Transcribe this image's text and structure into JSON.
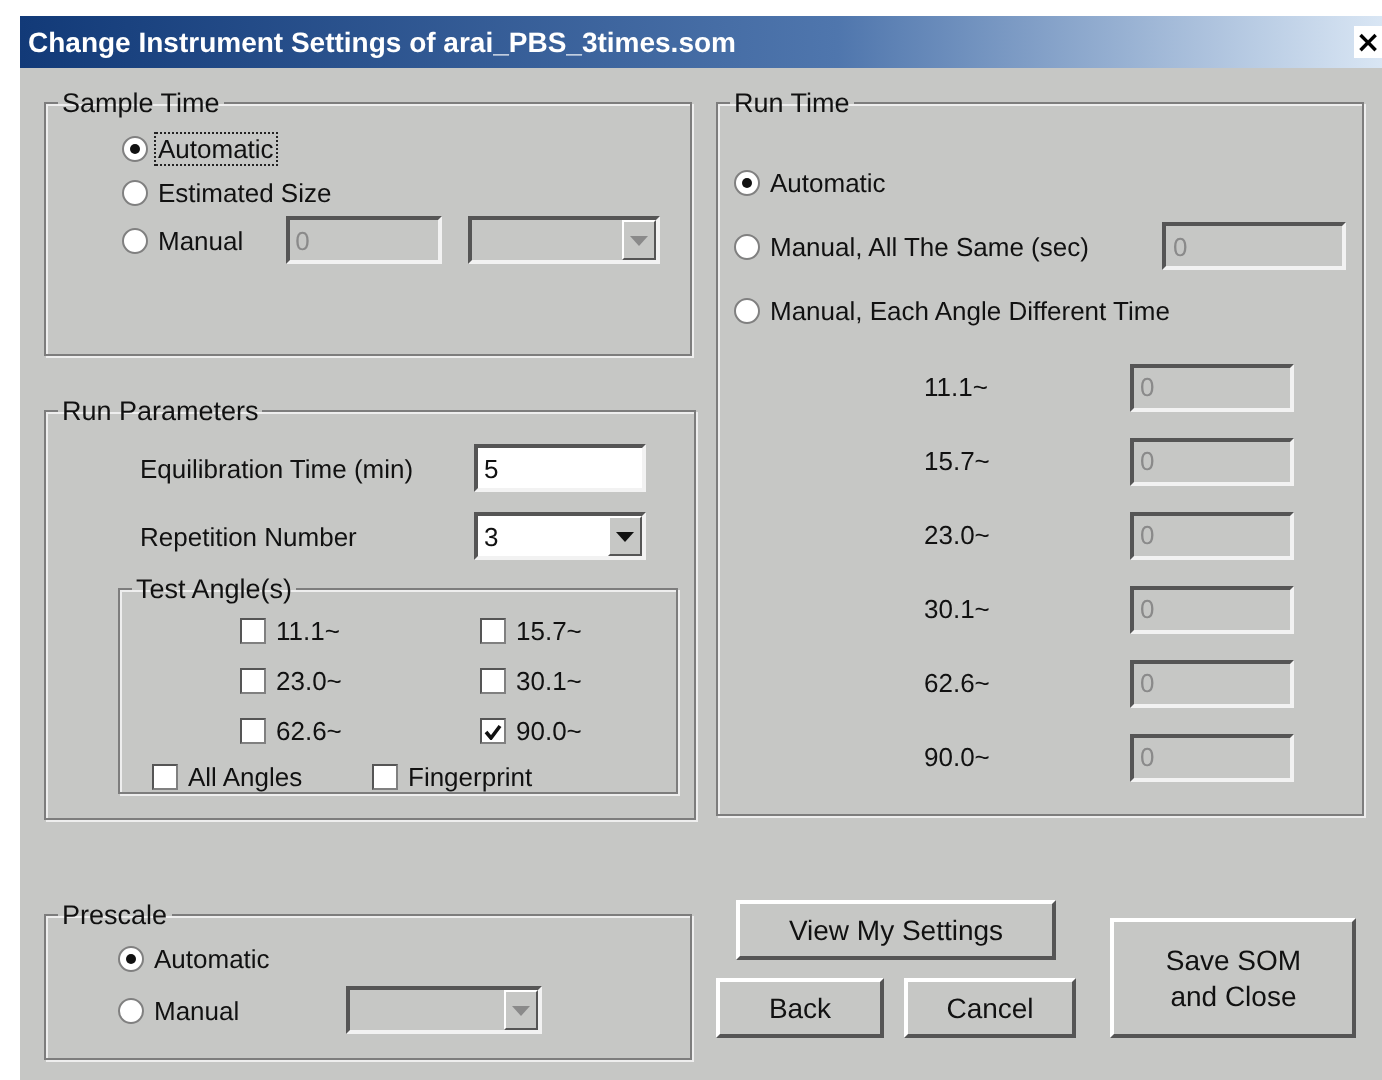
{
  "window": {
    "title": "Change Instrument Settings of arai_PBS_3times.som",
    "close": "×"
  },
  "sample_time": {
    "title": "Sample Time",
    "options": [
      {
        "label": "Automatic",
        "selected": true,
        "focused": true
      },
      {
        "label": "Estimated Size",
        "selected": false,
        "focused": false
      },
      {
        "label": "Manual",
        "selected": false,
        "focused": false
      }
    ],
    "manual_value": "0"
  },
  "run_parameters": {
    "title": "Run Parameters",
    "fields": [
      {
        "label": "Equilibration Time (min)",
        "value": "5",
        "kind": "text"
      },
      {
        "label": "Repetition Number",
        "value": "3",
        "kind": "dropdown"
      }
    ],
    "test_angles": {
      "title": "Test Angle(s)",
      "angles": [
        {
          "label": "11.1~",
          "checked": false
        },
        {
          "label": "15.7~",
          "checked": false
        },
        {
          "label": "23.0~",
          "checked": false
        },
        {
          "label": "30.1~",
          "checked": false
        },
        {
          "label": "62.6~",
          "checked": false
        },
        {
          "label": "90.0~",
          "checked": true
        }
      ],
      "extras": [
        {
          "label": "All Angles",
          "checked": false
        },
        {
          "label": "Fingerprint",
          "checked": false
        }
      ]
    }
  },
  "run_time": {
    "title": "Run Time",
    "options": [
      {
        "label": "Automatic",
        "selected": true
      },
      {
        "label": "Manual, All The Same (sec)",
        "selected": false
      },
      {
        "label": "Manual, Each Angle Different Time",
        "selected": false
      }
    ],
    "same_value": "0",
    "angles": [
      {
        "label": "11.1~",
        "value": "0"
      },
      {
        "label": "15.7~",
        "value": "0"
      },
      {
        "label": "23.0~",
        "value": "0"
      },
      {
        "label": "30.1~",
        "value": "0"
      },
      {
        "label": "62.6~",
        "value": "0"
      },
      {
        "label": "90.0~",
        "value": "0"
      }
    ]
  },
  "prescale": {
    "title": "Prescale",
    "options": [
      {
        "label": "Automatic",
        "selected": true
      },
      {
        "label": "Manual",
        "selected": false
      }
    ]
  },
  "buttons": {
    "view": "View My Settings",
    "back": "Back",
    "cancel": "Cancel",
    "save": "Save SOM\nand Close"
  }
}
